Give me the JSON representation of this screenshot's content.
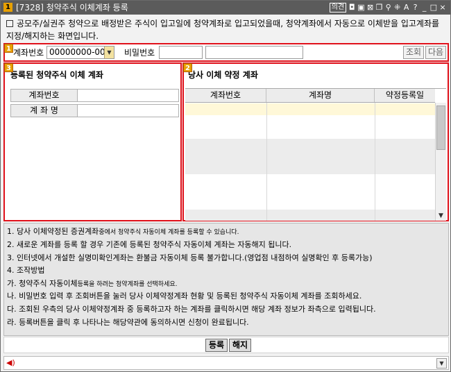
{
  "window": {
    "screen_no": "1",
    "title": "[7328] 청약주식 이체계좌 등록",
    "hotkey_label": "의견",
    "icons": [
      "pin-icon",
      "print-icon",
      "copy-icon",
      "window-icon",
      "hold-icon",
      "link-icon",
      "font-size-icon",
      "help-icon",
      "minimize-icon",
      "maximize-icon",
      "close-icon"
    ],
    "icon_glyphs": [
      "◘",
      "▣",
      "⊠",
      "❐",
      "⚲",
      "⁜",
      "A",
      "?",
      "_",
      "□",
      "×"
    ]
  },
  "description": "공모주/실권주 청약으로 배정받은 주식이 입고일에 청약계좌로 입고되었을때, 청약계좌에서 자동으로 이체받을 입고계좌를 지정/해지하는 화면입니다.",
  "section1": {
    "badge": "1",
    "account_label": "계좌번호",
    "account_value": "00000000-00",
    "password_label": "비밀번호",
    "password_value": "",
    "account_name_value": "",
    "query_button": "조회",
    "next_button": "다음"
  },
  "section3": {
    "badge": "3",
    "title": "등록된 청약주식 이체 계좌",
    "fields": [
      {
        "label": "계좌번호",
        "value": ""
      },
      {
        "label": "계 좌 명",
        "value": ""
      }
    ]
  },
  "section2": {
    "badge": "2",
    "title": "당사 이체 약정 계좌",
    "columns": [
      "계좌번호",
      "계좌명",
      "약정등록일"
    ]
  },
  "notes": {
    "line1_main": "1. 당사 이체약정된 증권계좌",
    "line1_small": "중에서 청약주식 자동이체 계좌를 등록할 수 있습니다.",
    "line2": "2. 새로운 계좌를 등록 할 경우 기존에 등록된 청약주식 자동이체 계좌는 자동해지 됩니다.",
    "line3": "3. 인터넷에서 개설한 실명미확인계좌는 환불금 자동이체 등록 불가합니다.(영업점 내점하여 실명확인 후 등록가능)",
    "line4": "4. 조작방법",
    "step_ga_main": "가. 청약주식 자동이체",
    "step_ga_small": "등록을 하려는 청약계좌를 선택하세요.",
    "step_na": "나. 비밀번호 입력 후 조회버튼을 눌러 당사 이체약정계좌 현황 및 등록된 청약주식 자동이체 계좌를 조회하세요.",
    "step_da": "다. 조회된 우측의 당사 이체약정계좌 중 등록하고자 하는 계좌를 클릭하시면 해당 계좌 정보가 좌측으로 입력됩니다.",
    "step_ra": "라. 등록버튼을 클릭 후 나타나는 해당약관에 동의하시면 신청이 완료됩니다."
  },
  "actions": {
    "register_button": "등록",
    "cancel_button": "해지"
  },
  "colors": {
    "section_border": "#e0101a",
    "badge": "#e8a000",
    "title_bar": "#5b5b5b",
    "selected_row": "#fff8d8"
  }
}
